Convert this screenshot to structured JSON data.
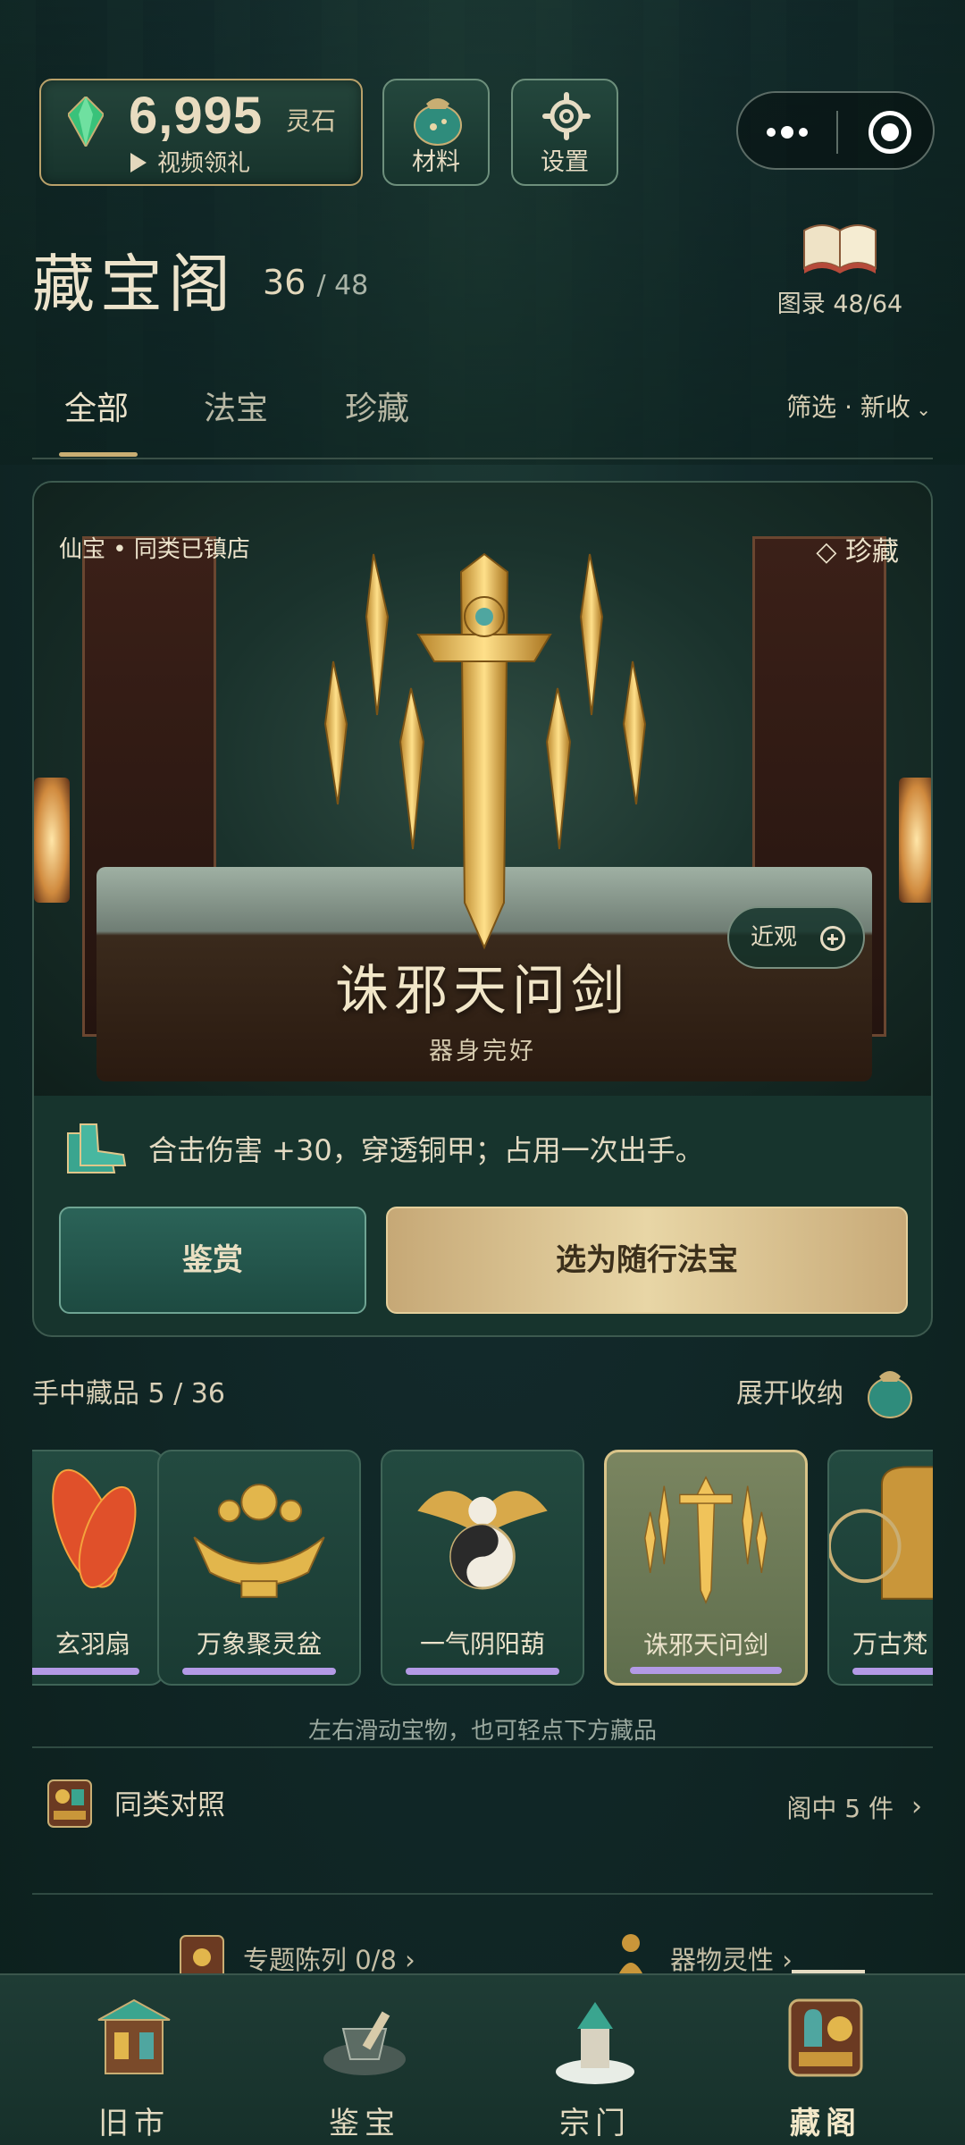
{
  "currency": {
    "amount": "6,995",
    "unit": "灵石",
    "video_label": "视频领礼"
  },
  "top_buttons": {
    "material": "材料",
    "settings": "设置"
  },
  "header": {
    "title": "藏宝阁",
    "count_owned": "36",
    "count_total": "/ 48",
    "catalog_label": "图录 48/64"
  },
  "tabs": [
    {
      "label": "全部"
    },
    {
      "label": "法宝"
    },
    {
      "label": "珍藏"
    }
  ],
  "filter_label": "筛选 · 新收",
  "feature": {
    "tag_left": "仙宝 • 同类已镇店",
    "tag_right": "◇ 珍藏",
    "closeup_label": "近观",
    "name": "诛邪天问剑",
    "state": "器身完好",
    "effect": "合击伤害 +30，穿透铜甲；占用一次出手。",
    "appraise_label": "鉴赏",
    "select_label": "选为随行法宝"
  },
  "collection": {
    "label": "手中藏品 5 / 36",
    "expand_label": "展开收纳",
    "items": [
      {
        "name": "玄羽扇"
      },
      {
        "name": "万象聚灵盆"
      },
      {
        "name": "一气阴阳葫"
      },
      {
        "name": "诛邪天问剑"
      },
      {
        "name": "万古梵"
      }
    ],
    "hint": "左右滑动宝物，也可轻点下方藏品"
  },
  "compare": {
    "label": "同类对照",
    "right": "阁中 5 件"
  },
  "more": {
    "exhibit": "专题陈列 0/8 ›",
    "spirit": "器物灵性 ›"
  },
  "nav": [
    {
      "label": "旧市"
    },
    {
      "label": "鉴宝"
    },
    {
      "label": "宗门"
    },
    {
      "label": "藏阁"
    }
  ],
  "colors": {
    "accent_gold": "#c9ae73",
    "bg": "#0f2824",
    "select_button": "#e8d6a6",
    "rarity_bar": "#b39ae6"
  }
}
